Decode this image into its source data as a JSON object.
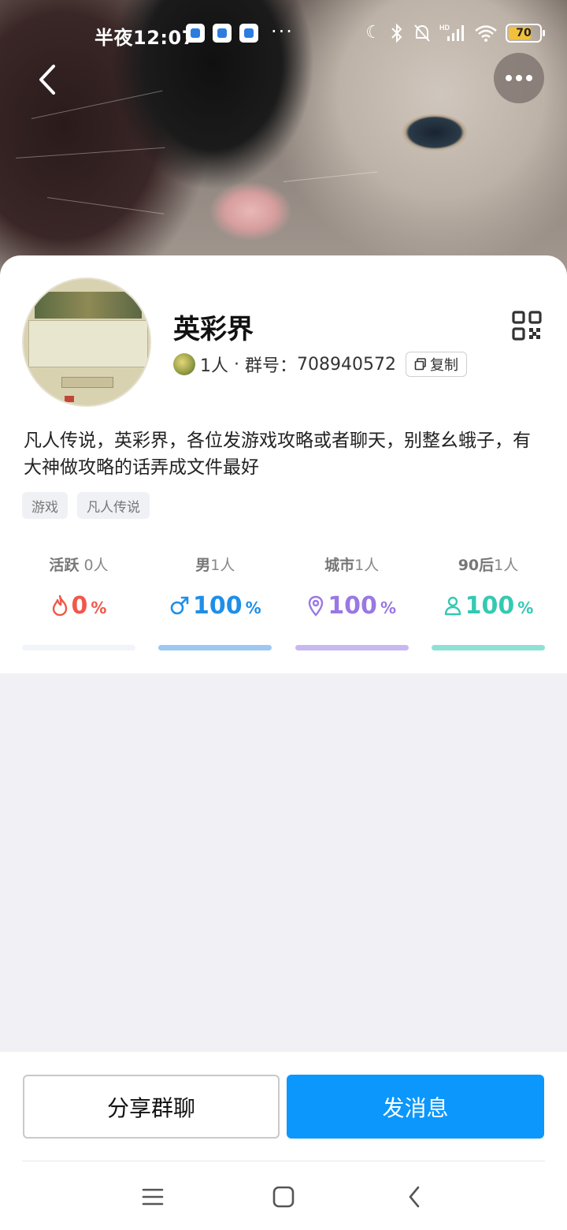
{
  "status_bar": {
    "time": "半夜12:07",
    "more_dots": "···",
    "battery_level": "70",
    "hd_label": "HD"
  },
  "header": {
    "back_icon": "chevron-left-icon",
    "more_icon": "more-horizontal-icon"
  },
  "group": {
    "name": "英彩界",
    "member_count": "1人",
    "separator": " · ",
    "group_number_label": "群号：",
    "group_number": "708940572",
    "copy_label": "复制",
    "description": "凡人传说，英彩界，各位发游戏攻略或者聊天，别整幺蛾子，有大神做攻略的话弄成文件最好",
    "tags": [
      "游戏",
      "凡人传说"
    ]
  },
  "stats": [
    {
      "label": "活跃",
      "count": "0人",
      "value": "0",
      "unit": "%",
      "icon": "flame-icon",
      "color": "#f0584a",
      "bar_color": "#f1f4f9",
      "bar_fill": 1.0
    },
    {
      "label": "男",
      "count": "1人",
      "value": "100",
      "unit": "%",
      "icon": "male-icon",
      "color": "#1e8fe8",
      "bar_color": "#9cc8f3",
      "bar_fill": 1.0
    },
    {
      "label": "城市",
      "count": "1人",
      "value": "100",
      "unit": "%",
      "icon": "location-pin-icon",
      "color": "#9a78e3",
      "bar_color": "#c7b8f0",
      "bar_fill": 1.0
    },
    {
      "label": "90后",
      "count": "1人",
      "value": "100",
      "unit": "%",
      "icon": "person-icon",
      "color": "#34c9b3",
      "bar_color": "#8fe1d4",
      "bar_fill": 1.0
    }
  ],
  "actions": {
    "share_label": "分享群聊",
    "send_label": "发消息"
  }
}
